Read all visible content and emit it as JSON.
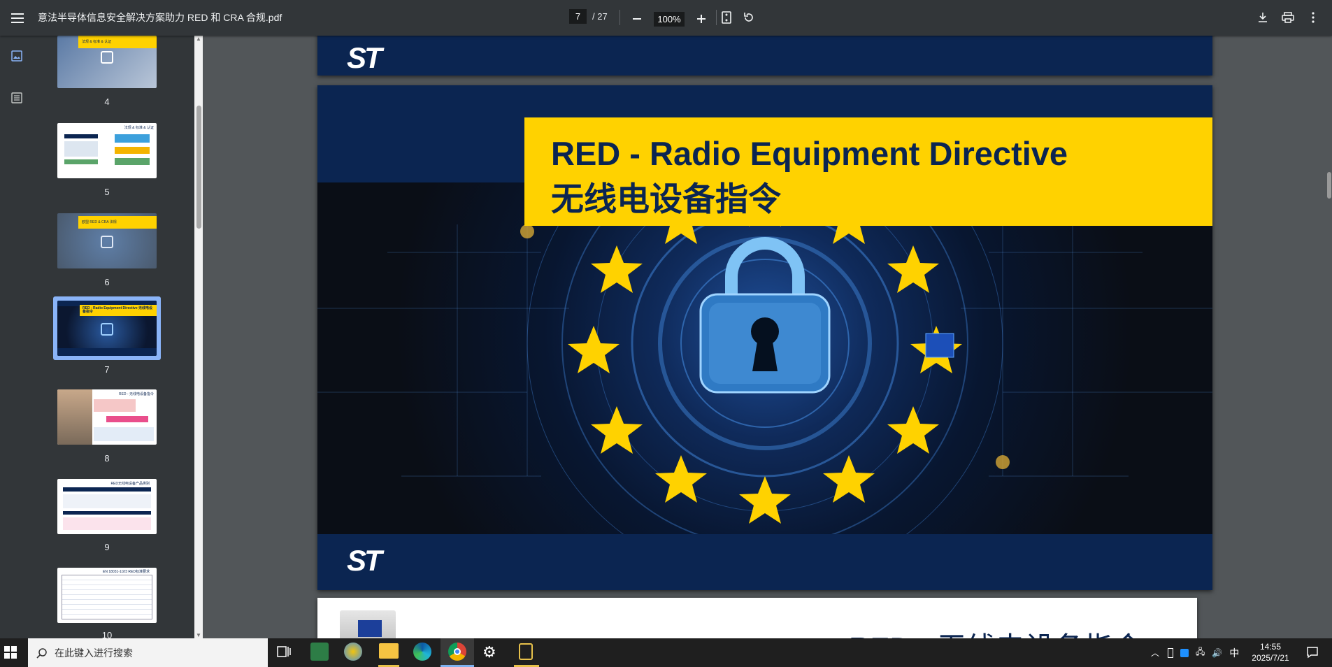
{
  "toolbar": {
    "title": "意法半导体信息安全解决方案助力 RED 和 CRA 合规.pdf",
    "current_page": "7",
    "total_pages": "/ 27",
    "zoom": "100%"
  },
  "thumbnails": [
    {
      "label": "4",
      "mini": "法规 & 标准 & 认证"
    },
    {
      "label": "5",
      "mini": "法规 & 标准 & 认证"
    },
    {
      "label": "6",
      "mini": "欧盟 RED & CRA 法规"
    },
    {
      "label": "7",
      "mini": "RED - Radio Equipment Directive 无线电设备指令"
    },
    {
      "label": "8",
      "mini": "RED - 无线电设备指令"
    },
    {
      "label": "9",
      "mini": "RED无线电设备产品类别"
    },
    {
      "label": "10",
      "mini": "EN 18031-1/2/3 RED标准要求"
    }
  ],
  "slide": {
    "title_en": "RED - Radio Equipment Directive",
    "title_cn": "无线电设备指令",
    "logo": "ST"
  },
  "next_slide_peek": "RED - 无线电设备指令",
  "taskbar": {
    "search_placeholder": "在此键入进行搜索",
    "time": "14:55",
    "date": "2025/7/21",
    "ime": "中"
  },
  "colors": {
    "st_blue": "#0b2551",
    "st_yellow": "#ffd200",
    "toolbar": "#323639",
    "viewer_bg": "#525659",
    "thumb_selected": "#8ab4f8"
  }
}
